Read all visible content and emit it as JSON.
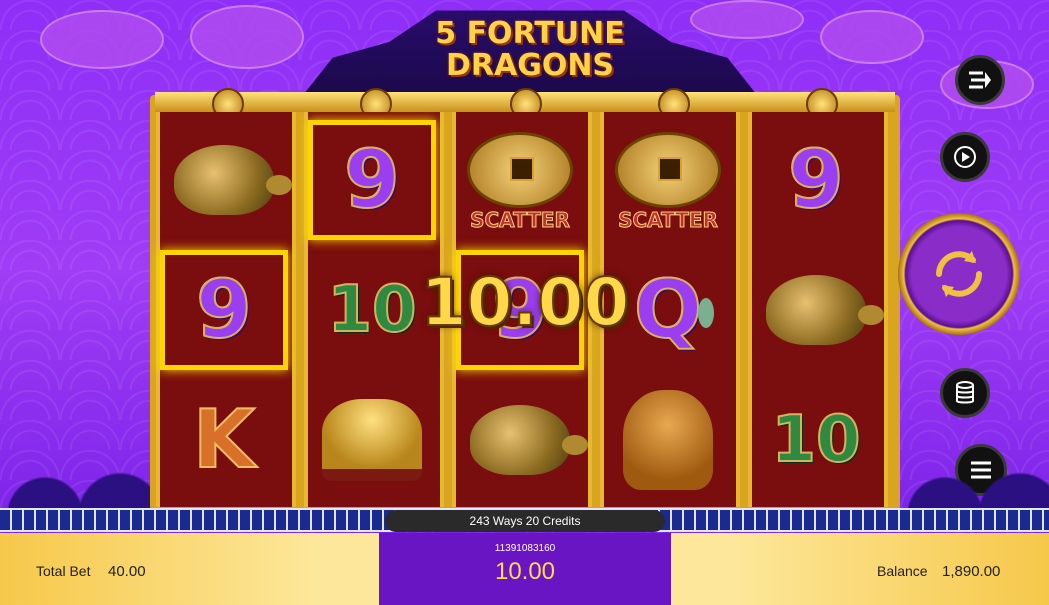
{
  "game": {
    "title_line1": "5 FORTUNE",
    "title_line2": "DRAGONS"
  },
  "reels": [
    {
      "symbols": [
        {
          "kind": "turtle"
        },
        {
          "kind": "text",
          "text": "9",
          "color": "purple",
          "win": true
        },
        {
          "kind": "text",
          "text": "K",
          "color": "orange"
        }
      ]
    },
    {
      "symbols": [
        {
          "kind": "text",
          "text": "9",
          "color": "purple",
          "win": true
        },
        {
          "kind": "text",
          "text": "10",
          "color": "green"
        },
        {
          "kind": "ingot"
        }
      ]
    },
    {
      "symbols": [
        {
          "kind": "scatter",
          "label": "SCATTER"
        },
        {
          "kind": "text",
          "text": "9",
          "color": "purple",
          "win": true
        },
        {
          "kind": "turtle"
        }
      ]
    },
    {
      "symbols": [
        {
          "kind": "scatter",
          "label": "SCATTER"
        },
        {
          "kind": "text",
          "text": "Q",
          "color": "purple"
        },
        {
          "kind": "lion"
        }
      ]
    },
    {
      "symbols": [
        {
          "kind": "text",
          "text": "9",
          "color": "purple"
        },
        {
          "kind": "turtle"
        },
        {
          "kind": "text",
          "text": "10",
          "color": "green"
        }
      ]
    }
  ],
  "win_overlay": "10.00",
  "side_buttons": {
    "turbo": "turbo-icon",
    "autoplay": "autoplay-icon",
    "spin": "spin-icon",
    "coins": "coins-icon",
    "menu": "menu-icon"
  },
  "info": {
    "ways_text": "243 Ways  20 Credits",
    "transaction_id": "11391083160",
    "win": "10.00"
  },
  "footer": {
    "total_bet_label": "Total Bet",
    "total_bet_value": "40.00",
    "balance_label": "Balance",
    "balance_value": "1,890.00"
  },
  "colors": {
    "win_highlight": "#ffd400",
    "bottom_panel": "#6a15c4",
    "gold": "#ffd84a"
  }
}
